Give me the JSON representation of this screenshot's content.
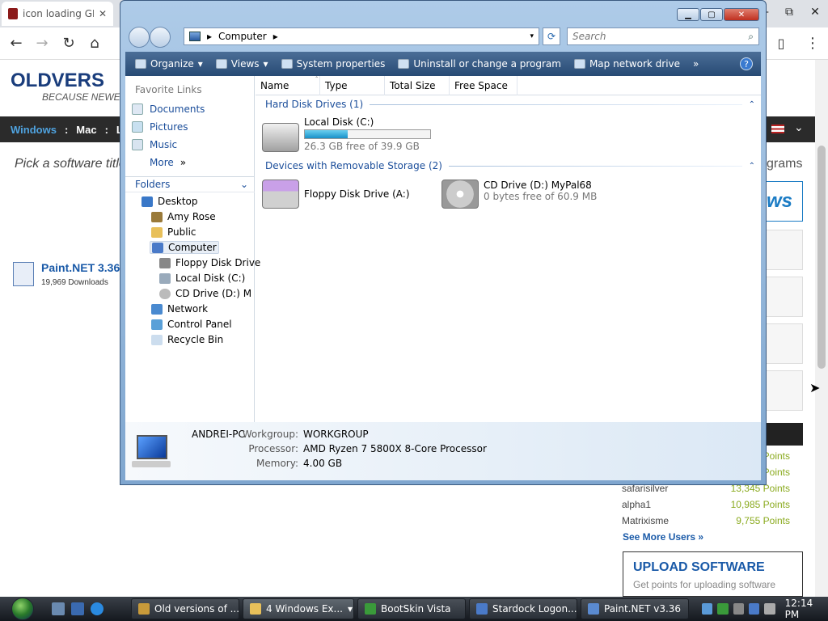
{
  "browser": {
    "tab_title": "icon loading GIF",
    "tab_close": "✕",
    "nav": {
      "back": "←",
      "forward": "→",
      "reload": "↻",
      "home": "⌂"
    },
    "window_controls": [
      "—",
      "⧉",
      "✕"
    ],
    "right_icons": [
      "▯",
      "⋮"
    ]
  },
  "site": {
    "logo": "OLDVERS",
    "tagline": "BECAUSE NEWER I",
    "nav": [
      "Windows",
      ":",
      "Mac",
      ":",
      "L"
    ],
    "nav_flag_icon": "flag-icon",
    "nav_chevron": "⌄",
    "search_prompt": "Pick a software title",
    "programs_tail": "grams",
    "vista_tail": "ws",
    "paintnet": {
      "title": "Paint.NET 3.36",
      "downloads": "19,969 Downloads"
    },
    "leaderboard": [
      {
        "name": "",
        "points": "Points"
      },
      {
        "name": "",
        "points": "Points"
      },
      {
        "name": "safarisilver",
        "points": "13,345 Points"
      },
      {
        "name": "alpha1",
        "points": "10,985 Points"
      },
      {
        "name": "Matrixisme",
        "points": "9,755 Points"
      }
    ],
    "see_more": "See More Users »",
    "upload_title": "UPLOAD SOFTWARE",
    "upload_sub": "Get points for uploading software"
  },
  "explorer": {
    "address": {
      "location": "Computer",
      "separator": "▸",
      "dropdown": "▾"
    },
    "refresh_icon": "⟳",
    "search_placeholder": "Search",
    "search_icon": "⌕",
    "window_controls": {
      "minimize": "▁",
      "maximize": "▢",
      "close": "✕"
    },
    "commands": [
      {
        "label": "Organize",
        "arrow": "▾"
      },
      {
        "label": "Views",
        "arrow": "▾"
      },
      {
        "label": "System properties",
        "arrow": ""
      },
      {
        "label": "Uninstall or change a program",
        "arrow": ""
      },
      {
        "label": "Map network drive",
        "arrow": ""
      }
    ],
    "more_chevron": "»",
    "help": "?",
    "favorite_links_header": "Favorite Links",
    "favorite_links": [
      "Documents",
      "Pictures",
      "Music"
    ],
    "more_label": "More",
    "more_arrow": "»",
    "folders_header": "Folders",
    "folders_chevron": "⌄",
    "tree": [
      {
        "label": "Desktop",
        "level": 0
      },
      {
        "label": "Amy Rose",
        "level": 1
      },
      {
        "label": "Public",
        "level": 1
      },
      {
        "label": "Computer",
        "level": 1,
        "selected": true
      },
      {
        "label": "Floppy Disk Drive",
        "level": 2
      },
      {
        "label": "Local Disk (C:)",
        "level": 2
      },
      {
        "label": "CD Drive (D:) MyP",
        "level": 2
      },
      {
        "label": "Network",
        "level": 1
      },
      {
        "label": "Control Panel",
        "level": 1
      },
      {
        "label": "Recycle Bin",
        "level": 1
      }
    ],
    "columns": [
      "Name",
      "Type",
      "Total Size",
      "Free Space"
    ],
    "sort_caret": "ˆ",
    "groups": [
      {
        "label": "Hard Disk Drives (1)",
        "collapse": "⌃"
      },
      {
        "label": "Devices with Removable Storage (2)",
        "collapse": "⌃"
      }
    ],
    "hard_disks": [
      {
        "name": "Local Disk (C:)",
        "free_text": "26.3 GB free of 39.9 GB",
        "used_fraction": 0.34
      }
    ],
    "removable": [
      {
        "name": "Floppy Disk Drive (A:)",
        "sub": ""
      },
      {
        "name": "CD Drive (D:) MyPal68",
        "sub": "0 bytes free of 60.9 MB"
      }
    ],
    "details": {
      "computer_name": "ANDREI-PC",
      "rows": [
        {
          "key": "Workgroup:",
          "value": "WORKGROUP"
        },
        {
          "key": "Processor:",
          "value": "AMD Ryzen 7 5800X 8-Core Processor"
        },
        {
          "key": "Memory:",
          "value": "4.00 GB"
        }
      ]
    }
  },
  "taskbar": {
    "buttons": [
      {
        "label": "Old versions of ...",
        "active": false
      },
      {
        "label": "4 Windows Ex...",
        "active": true,
        "arrow": "▾"
      },
      {
        "label": "BootSkin Vista",
        "active": false
      },
      {
        "label": "Stardock Logon...",
        "active": false
      },
      {
        "label": "Paint.NET v3.36",
        "active": false
      }
    ],
    "clock": "12:14 PM"
  },
  "colors": {
    "accent": "#1a4d9a",
    "command_bar": "#274a74",
    "bar_fill": "#1890c8",
    "points_green": "#8aaa1e"
  }
}
